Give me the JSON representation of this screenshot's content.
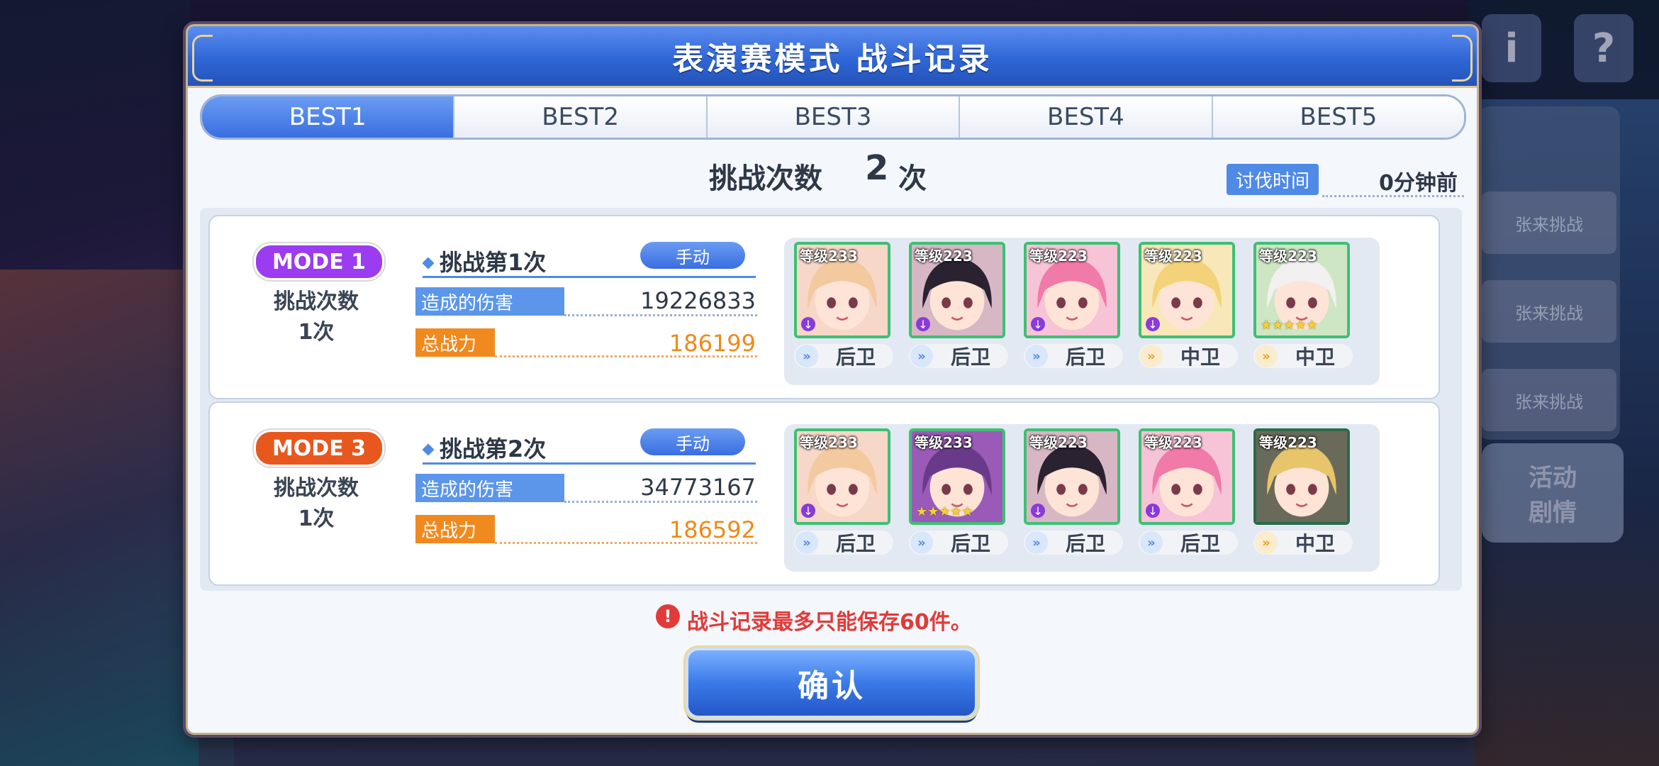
{
  "background": {
    "right_items": [
      "张来挑战",
      "张来挑战",
      "张来挑战"
    ],
    "right_button": "活动\n剧情",
    "top_icons": [
      "i",
      "?"
    ]
  },
  "dialog": {
    "title": "表演赛模式 战斗记录",
    "tabs": [
      "BEST1",
      "BEST2",
      "BEST3",
      "BEST4",
      "BEST5"
    ],
    "active_tab": "BEST1",
    "challenge_count_label": "挑战次数",
    "challenge_count_value": "2",
    "challenge_count_unit": "次",
    "time_label": "讨伐时间",
    "time_value": "0分钟前",
    "records": [
      {
        "mode": "MODE 1",
        "mode_color": "#9b3cf0",
        "count_label": "挑战次数",
        "count_value": "1次",
        "attempt": "挑战第1次",
        "play_type": "手动",
        "damage_label": "造成的伤害",
        "damage": "19226833",
        "power_label": "总战力",
        "power": "186199",
        "team": [
          {
            "level": "等级233",
            "position": "后卫",
            "pos_type": "back",
            "hair": "#f3c9a0",
            "bg": "#f6d7c8",
            "marker": "rank"
          },
          {
            "level": "等级223",
            "position": "后卫",
            "pos_type": "back",
            "hair": "#2a2230",
            "bg": "#d8b7c4",
            "marker": "rank"
          },
          {
            "level": "等级223",
            "position": "后卫",
            "pos_type": "back",
            "hair": "#f07aa8",
            "bg": "#f7c3d6",
            "marker": "rank"
          },
          {
            "level": "等级223",
            "position": "中卫",
            "pos_type": "mid",
            "hair": "#f4d27a",
            "bg": "#f8e7b8",
            "marker": "rank"
          },
          {
            "level": "等级223",
            "position": "中卫",
            "pos_type": "mid",
            "hair": "#f2f0f0",
            "bg": "#cfe6c4",
            "marker": "stars",
            "stars": "★★★★★"
          }
        ]
      },
      {
        "mode": "MODE 3",
        "mode_color": "#e8581e",
        "count_label": "挑战次数",
        "count_value": "1次",
        "attempt": "挑战第2次",
        "play_type": "手动",
        "damage_label": "造成的伤害",
        "damage": "34773167",
        "power_label": "总战力",
        "power": "186592",
        "team": [
          {
            "level": "等级233",
            "position": "后卫",
            "pos_type": "back",
            "hair": "#f3c9a0",
            "bg": "#f6d7c8",
            "marker": "rank"
          },
          {
            "level": "等级233",
            "position": "后卫",
            "pos_type": "back",
            "hair": "#6a3a8a",
            "bg": "#9a5ab8",
            "marker": "stars",
            "stars": "★★★★★"
          },
          {
            "level": "等级223",
            "position": "后卫",
            "pos_type": "back",
            "hair": "#2a2230",
            "bg": "#d8b7c4",
            "marker": "rank"
          },
          {
            "level": "等级223",
            "position": "后卫",
            "pos_type": "back",
            "hair": "#f07aa8",
            "bg": "#f7c3d6",
            "marker": "rank"
          },
          {
            "level": "等级223",
            "position": "中卫",
            "pos_type": "mid",
            "hair": "#e8c46a",
            "bg": "#6a6a5a",
            "marker": "none"
          }
        ]
      }
    ],
    "notice": "战斗记录最多只能保存60件。",
    "confirm_label": "确认"
  }
}
